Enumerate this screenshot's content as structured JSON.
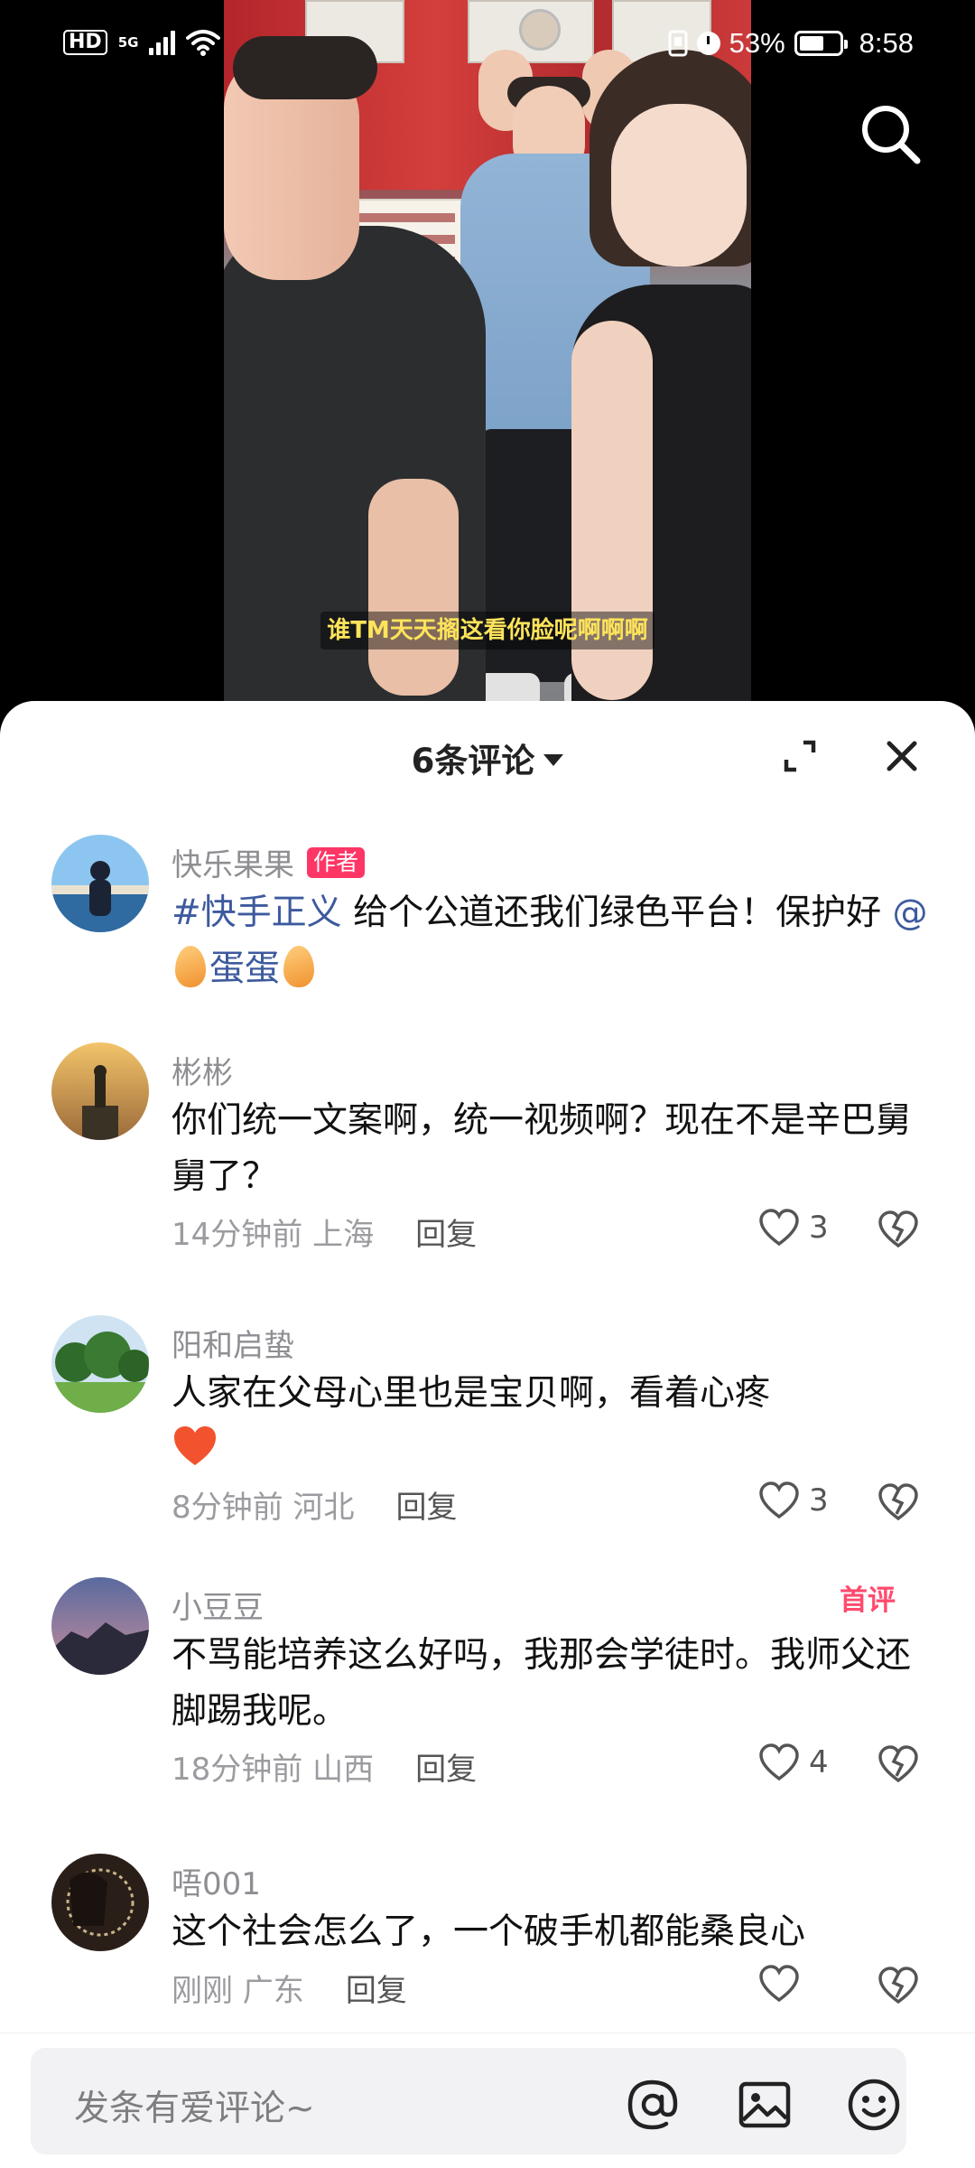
{
  "status_bar": {
    "hd": "HD",
    "network": "5G",
    "battery": "53%",
    "time": "8:58"
  },
  "video": {
    "caption": "谁TM天天搁这看你脸呢啊啊啊"
  },
  "comments_panel": {
    "title": "6条评论",
    "input_placeholder": "发条有爱评论~"
  },
  "comments": [
    {
      "user": "快乐果果",
      "badge": "作者",
      "hashtag": "#快手正义",
      "text": " 给个公道还我们绿色平台！保护好 ",
      "mention_prefix": "@",
      "mention_name": "蛋蛋"
    },
    {
      "user": "彬彬",
      "text": "你们统一文案啊，统一视频啊？现在不是辛巴舅舅了？",
      "time": "14分钟前 上海",
      "reply": "回复",
      "likes": "3"
    },
    {
      "user": "阳和启蛰",
      "text": "人家在父母心里也是宝贝啊，看着心疼",
      "time": "8分钟前 河北",
      "reply": "回复",
      "likes": "3"
    },
    {
      "user": "小豆豆",
      "badge": "首评",
      "text": "不骂能培养这么好吗，我那会学徒时。我师父还脚踢我呢。",
      "time": "18分钟前 山西",
      "reply": "回复",
      "likes": "4"
    },
    {
      "user": "唔001",
      "text": "这个社会怎么了，一个破手机都能桑良心",
      "time": "刚刚 广东",
      "reply": "回复",
      "likes": ""
    }
  ],
  "icons": {
    "search": "search-icon",
    "expand": "expand-icon",
    "close": "close-icon",
    "like": "heart-outline-icon",
    "dislike": "broken-heart-icon",
    "mention": "at-icon",
    "image": "image-icon",
    "emoji": "emoji-icon"
  },
  "colors": {
    "author_badge": "#fe3666",
    "hashtag": "#3d5a9e",
    "first_comment_badge": "#ff4b6e",
    "caption": "#ffe45a"
  }
}
